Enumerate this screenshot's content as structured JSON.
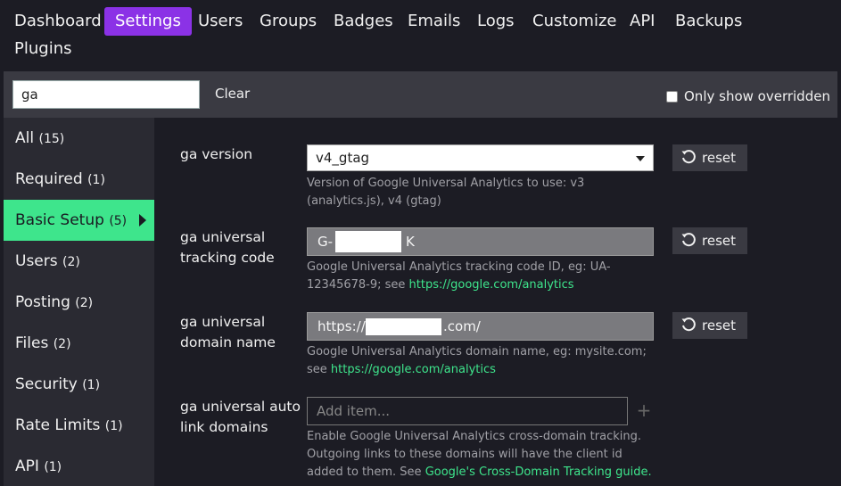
{
  "nav": {
    "items": [
      {
        "label": "Dashboard",
        "active": false
      },
      {
        "label": "Settings",
        "active": true
      },
      {
        "label": "Users",
        "active": false
      },
      {
        "label": "Groups",
        "active": false
      },
      {
        "label": "Badges",
        "active": false
      },
      {
        "label": "Emails",
        "active": false
      },
      {
        "label": "Logs",
        "active": false
      },
      {
        "label": "Customize",
        "active": false
      },
      {
        "label": "API",
        "active": false
      },
      {
        "label": "Backups",
        "active": false
      },
      {
        "label": "Plugins",
        "active": false
      }
    ]
  },
  "filter": {
    "search_value": "ga",
    "clear_label": "Clear",
    "only_overridden_label": "Only show overridden",
    "only_overridden_checked": false
  },
  "sidebar": {
    "items": [
      {
        "label": "All",
        "count": "(15)",
        "active": false
      },
      {
        "label": "Required",
        "count": "(1)",
        "active": false
      },
      {
        "label": "Basic Setup",
        "count": "(5)",
        "active": true
      },
      {
        "label": "Users",
        "count": "(2)",
        "active": false
      },
      {
        "label": "Posting",
        "count": "(2)",
        "active": false
      },
      {
        "label": "Files",
        "count": "(2)",
        "active": false
      },
      {
        "label": "Security",
        "count": "(1)",
        "active": false
      },
      {
        "label": "Rate Limits",
        "count": "(1)",
        "active": false
      },
      {
        "label": "API",
        "count": "(1)",
        "active": false
      }
    ]
  },
  "settings": {
    "ga_version": {
      "label": "ga version",
      "value": "v4_gtag",
      "desc": "Version of Google Universal Analytics to use: v3 (analytics.js), v4 (gtag)",
      "reset_label": "reset"
    },
    "ga_tracking_code": {
      "label": "ga universal tracking code",
      "value_prefix": "G-",
      "value_suffix": "K",
      "desc": "Google Universal Analytics tracking code ID, eg: UA-12345678-9; see ",
      "desc_link": "https://google.com/analytics",
      "reset_label": "reset"
    },
    "ga_domain_name": {
      "label": "ga universal domain name",
      "value_prefix": "https://",
      "value_suffix": ".com/",
      "desc": "Google Universal Analytics domain name, eg: mysite.com; see ",
      "desc_link": "https://google.com/analytics",
      "reset_label": "reset"
    },
    "ga_auto_link": {
      "label": "ga universal auto link domains",
      "placeholder": "Add item...",
      "add_symbol": "+",
      "desc": "Enable Google Universal Analytics cross-domain tracking. Outgoing links to these domains will have the client id added to them. See ",
      "desc_link": "Google's Cross-Domain Tracking guide.",
      "add_symbol_color": "#666666"
    }
  },
  "colors": {
    "accent_purple": "#8b32e6",
    "accent_green": "#3ee58c"
  }
}
